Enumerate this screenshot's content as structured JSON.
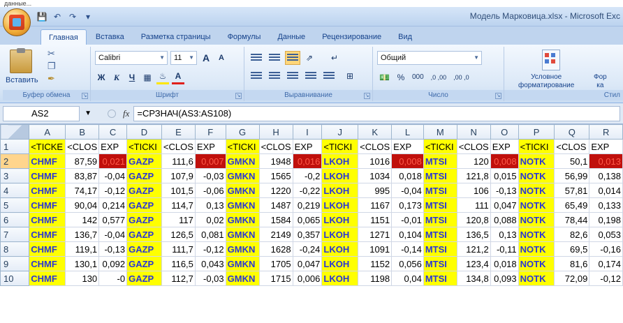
{
  "page_header": "данные...",
  "window": {
    "title": "Модель Марковица.xlsx - Microsoft Exc",
    "office_button_icon": "office-logo-icon",
    "quick_access": [
      "save-icon",
      "undo-icon",
      "redo-icon",
      "customize-qat-icon"
    ]
  },
  "tabs": [
    {
      "label": "Главная",
      "active": true
    },
    {
      "label": "Вставка"
    },
    {
      "label": "Разметка страницы"
    },
    {
      "label": "Формулы"
    },
    {
      "label": "Данные"
    },
    {
      "label": "Рецензирование"
    },
    {
      "label": "Вид"
    }
  ],
  "ribbon": {
    "clipboard": {
      "paste": "Вставить",
      "label": "Буфер обмена"
    },
    "font": {
      "name": "Calibri",
      "size": "11",
      "grow": "A",
      "shrink": "A",
      "bold": "Ж",
      "italic": "К",
      "underline": "Ч",
      "label": "Шрифт",
      "fill_color": "#ffe600",
      "font_color": "#e0201b"
    },
    "alignment": {
      "label": "Выравнивание"
    },
    "number": {
      "format": "Общий",
      "percent": "%",
      "thousands": "000",
      "inc_decimal": ",0 ,00",
      "dec_decimal": ",00 ,0",
      "label": "Число"
    },
    "styles": {
      "conditional_line1": "Условное",
      "conditional_line2": "форматирование",
      "next_line1": "Фор",
      "next_line2": "ка",
      "label": "Стил"
    }
  },
  "formula_bar": {
    "cell_ref": "AS2",
    "fx": "fx",
    "formula": "=СРЗНАЧ(AS3:AS108)"
  },
  "sheet": {
    "columns": [
      "A",
      "B",
      "C",
      "D",
      "E",
      "F",
      "G",
      "H",
      "I",
      "J",
      "K",
      "L",
      "M",
      "N",
      "O",
      "P",
      "Q",
      "R"
    ],
    "rows": [
      {
        "n": "1",
        "cells": [
          "<TICKE",
          "<CLOS",
          "EXP",
          "<TICKI",
          "<CLOS",
          "EXP",
          "<TICKI",
          "<CLOS",
          "EXP",
          "<TICKI",
          "<CLOS",
          "EXP",
          "<TICKI",
          "<CLOS",
          "EXP",
          "<TICKI",
          "<CLOS",
          "EXP"
        ]
      },
      {
        "n": "2",
        "cells": [
          "CHMF",
          "87,59",
          "0,021",
          "GAZP",
          "111,6",
          "0,007",
          "GMKN",
          "1948",
          "0,016",
          "LKOH",
          "1016",
          "0,008",
          "MTSI",
          "120",
          "0,008",
          "NOTK",
          "50,1",
          "0,013"
        ]
      },
      {
        "n": "3",
        "cells": [
          "CHMF",
          "83,87",
          "-0,04",
          "GAZP",
          "107,9",
          "-0,03",
          "GMKN",
          "1565",
          "-0,2",
          "LKOH",
          "1034",
          "0,018",
          "MTSI",
          "121,8",
          "0,015",
          "NOTK",
          "56,99",
          "0,138"
        ]
      },
      {
        "n": "4",
        "cells": [
          "CHMF",
          "74,17",
          "-0,12",
          "GAZP",
          "101,5",
          "-0,06",
          "GMKN",
          "1220",
          "-0,22",
          "LKOH",
          "995",
          "-0,04",
          "MTSI",
          "106",
          "-0,13",
          "NOTK",
          "57,81",
          "0,014"
        ]
      },
      {
        "n": "5",
        "cells": [
          "CHMF",
          "90,04",
          "0,214",
          "GAZP",
          "114,7",
          "0,13",
          "GMKN",
          "1487",
          "0,219",
          "LKOH",
          "1167",
          "0,173",
          "MTSI",
          "111",
          "0,047",
          "NOTK",
          "65,49",
          "0,133"
        ]
      },
      {
        "n": "6",
        "cells": [
          "CHMF",
          "142",
          "0,577",
          "GAZP",
          "117",
          "0,02",
          "GMKN",
          "1584",
          "0,065",
          "LKOH",
          "1151",
          "-0,01",
          "MTSI",
          "120,8",
          "0,088",
          "NOTK",
          "78,44",
          "0,198"
        ]
      },
      {
        "n": "7",
        "cells": [
          "CHMF",
          "136,7",
          "-0,04",
          "GAZP",
          "126,5",
          "0,081",
          "GMKN",
          "2149",
          "0,357",
          "LKOH",
          "1271",
          "0,104",
          "MTSI",
          "136,5",
          "0,13",
          "NOTK",
          "82,6",
          "0,053"
        ]
      },
      {
        "n": "8",
        "cells": [
          "CHMF",
          "119,1",
          "-0,13",
          "GAZP",
          "111,7",
          "-0,12",
          "GMKN",
          "1628",
          "-0,24",
          "LKOH",
          "1091",
          "-0,14",
          "MTSI",
          "121,2",
          "-0,11",
          "NOTK",
          "69,5",
          "-0,16"
        ]
      },
      {
        "n": "9",
        "cells": [
          "CHMF",
          "130,1",
          "0,092",
          "GAZP",
          "116,5",
          "0,043",
          "GMKN",
          "1705",
          "0,047",
          "LKOH",
          "1152",
          "0,056",
          "MTSI",
          "123,4",
          "0,018",
          "NOTK",
          "81,6",
          "0,174"
        ]
      },
      {
        "n": "10",
        "cells": [
          "CHMF",
          "130",
          "-0",
          "GAZP",
          "112,7",
          "-0,03",
          "GMKN",
          "1715",
          "0,006",
          "LKOH",
          "1198",
          "0,04",
          "MTSI",
          "134,8",
          "0,093",
          "NOTK",
          "72,09",
          "-0,12"
        ]
      }
    ],
    "selected_row": "2",
    "colors": {
      "ticker_fill": "#ffff00",
      "ticker_text": "#2a36d6",
      "highlight_fill": "#c0100c"
    }
  }
}
